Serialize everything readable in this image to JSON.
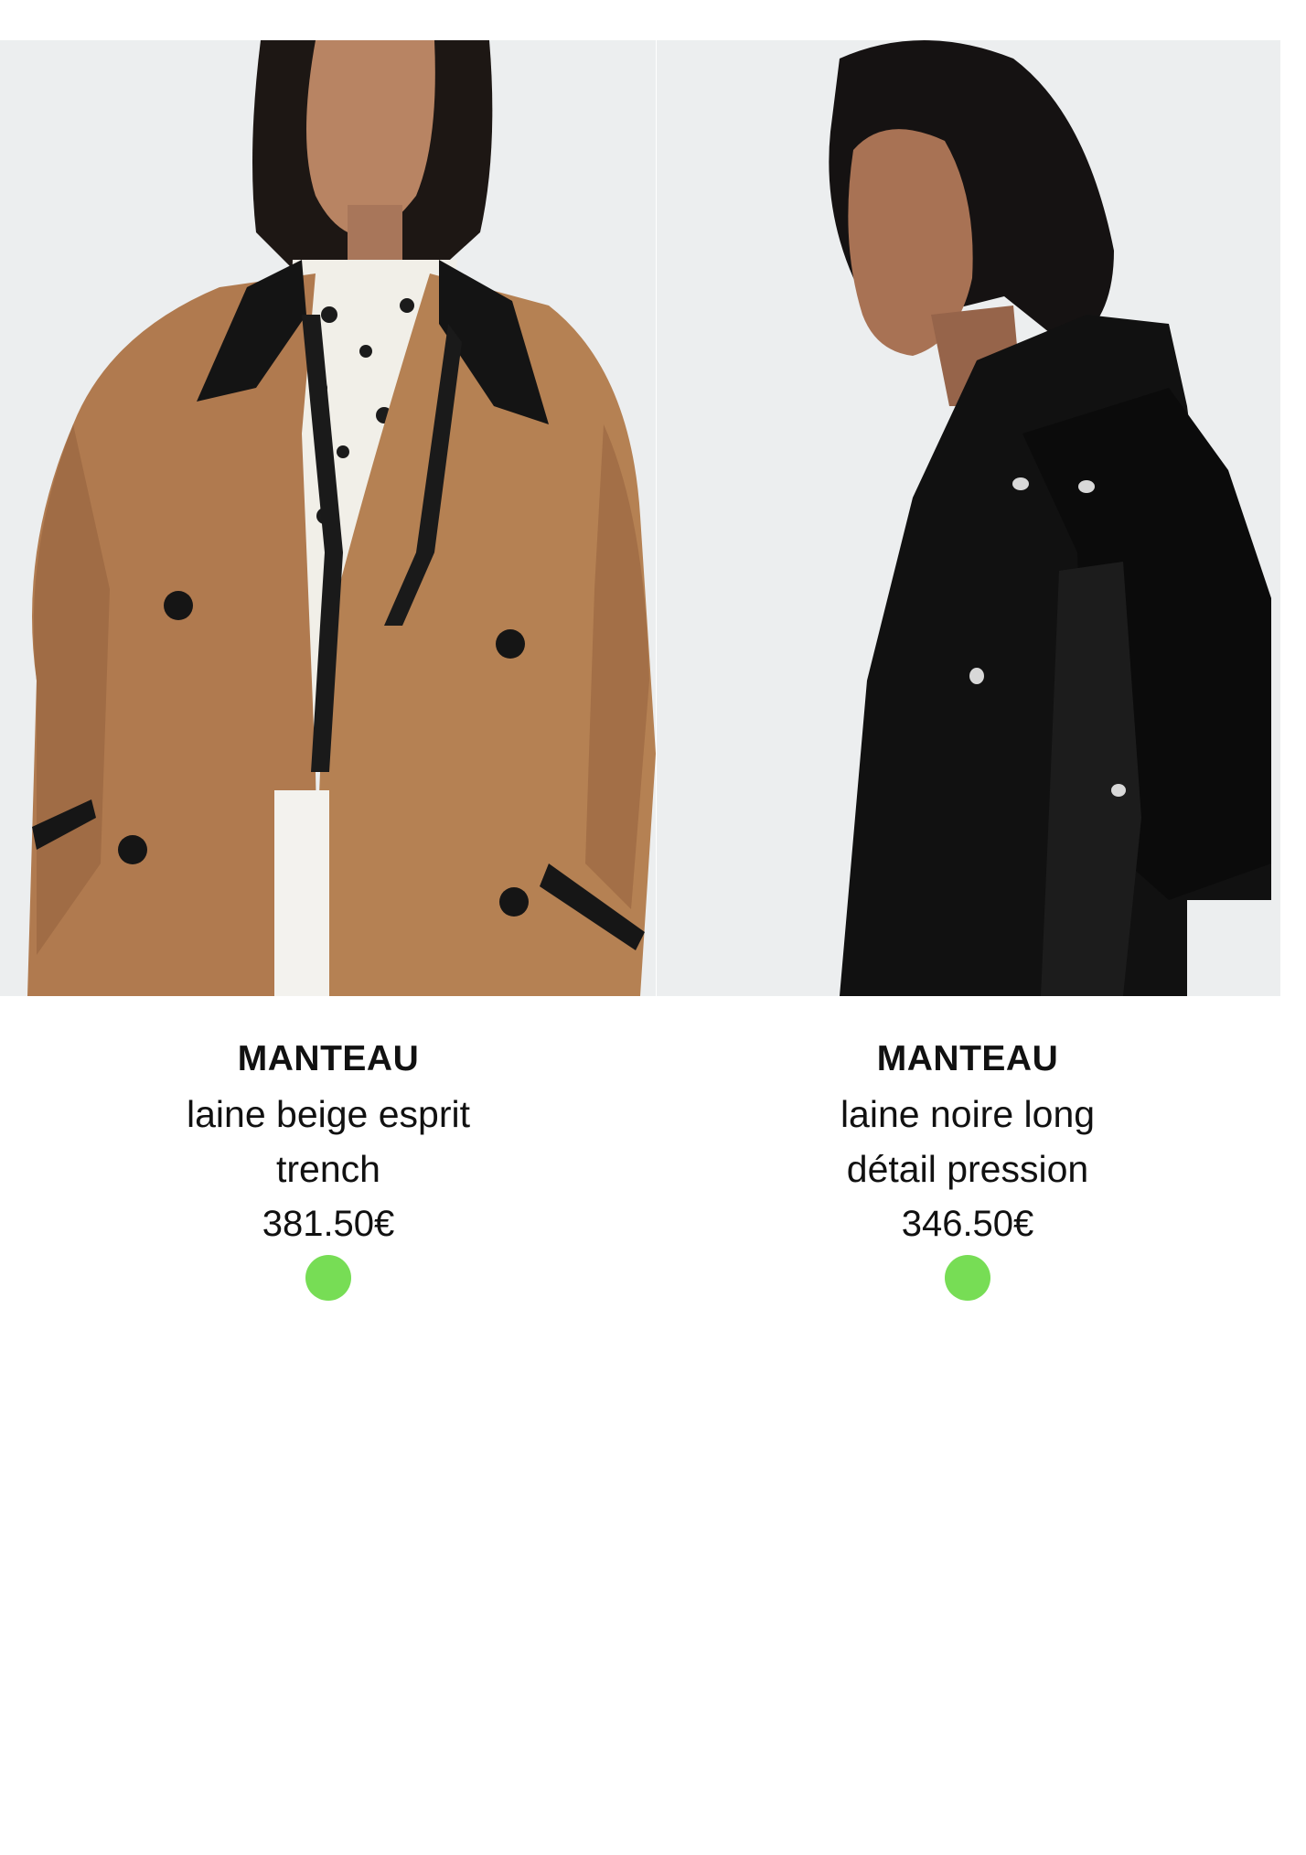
{
  "colors": {
    "background": "#ffffff",
    "text": "#111111",
    "stock_indicator": "#77dd55"
  },
  "products": [
    {
      "image": {
        "subject": "model-in-camel-coat",
        "coat_color": "#b07a4f"
      },
      "name": "MANTEAU",
      "description_lines": [
        "laine beige esprit",
        "trench"
      ],
      "price": "381.50€",
      "stock_status_color": "#77dd55"
    },
    {
      "image": {
        "subject": "model-in-black-coat",
        "coat_color": "#111111"
      },
      "name": "MANTEAU",
      "description_lines": [
        "laine noire long",
        "détail pression"
      ],
      "price": "346.50€",
      "stock_status_color": "#77dd55"
    }
  ]
}
